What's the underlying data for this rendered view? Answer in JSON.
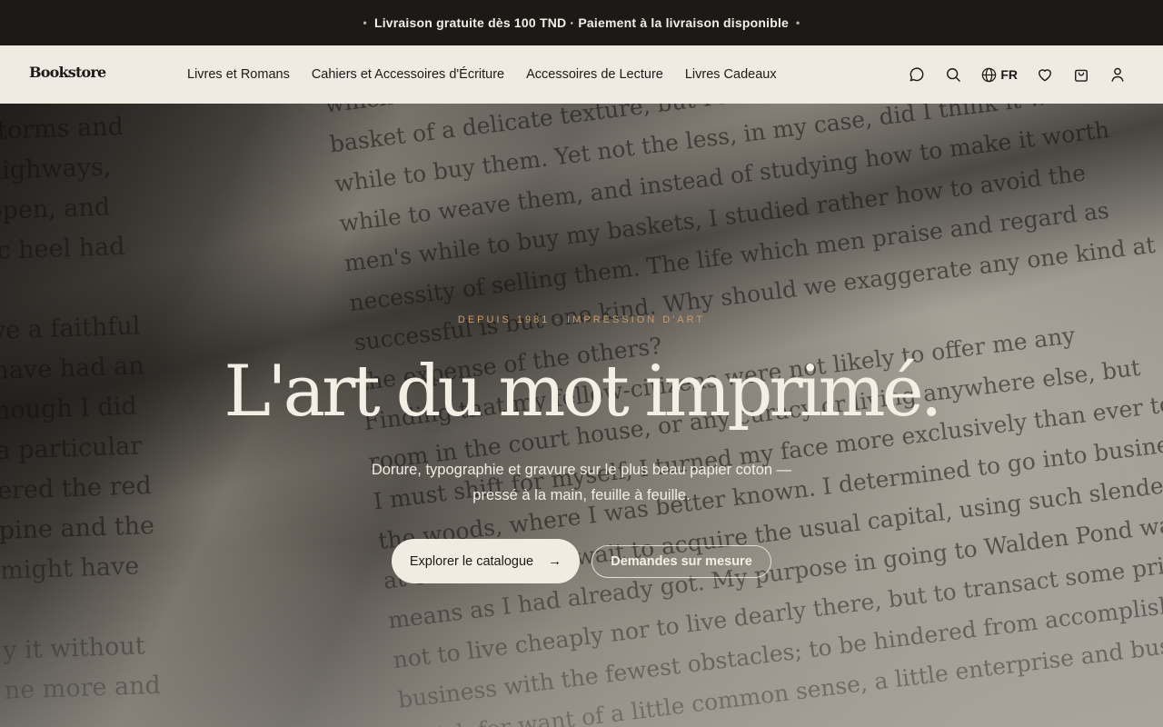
{
  "announcement": {
    "bullet_left": "•",
    "text": "Livraison gratuite dès 100 TND · Paiement à la livraison disponible",
    "bullet_right": "•"
  },
  "header": {
    "logo": "Bookstore",
    "menu": [
      {
        "label": "Livres et Romans"
      },
      {
        "label": "Cahiers et Accessoires d'Écriture"
      },
      {
        "label": "Accessoires de Lecture"
      },
      {
        "label": "Livres Cadeaux"
      }
    ],
    "icons": [
      "chat-icon",
      "search-icon",
      "globe-icon",
      "heart-icon",
      "cart-icon",
      "user-icon"
    ],
    "language": "FR"
  },
  "hero": {
    "eyebrow": "DEPUIS 1981 · IMPRESSION D'ART",
    "headline": "L'art du mot imprimé.",
    "subtitle": "Dorure, typographie et gravure sur le plus beau papier coton — pressé à la main, feuille à feuille.",
    "cta_primary": "Explorer le catalogue",
    "cta_primary_icon": "arrow-right-icon",
    "cta_secondary": "Demandes sur mesure"
  },
  "colors": {
    "topbar_bg": "#1c1917",
    "nav_bg": "#efebe2",
    "accent": "#c79c6a",
    "text_light": "#f4efe4"
  }
}
